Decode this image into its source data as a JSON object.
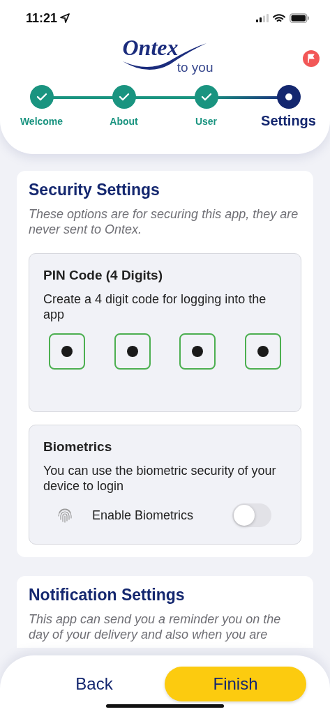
{
  "status_bar": {
    "time": "11:21"
  },
  "logo": {
    "brand": "Ontex",
    "tagline": "to you"
  },
  "steps": [
    {
      "label": "Welcome",
      "kind": "done"
    },
    {
      "label": "About",
      "kind": "done"
    },
    {
      "label": "User",
      "kind": "done"
    },
    {
      "label": "Settings",
      "kind": "current"
    }
  ],
  "security": {
    "title": "Security Settings",
    "description": "These options are for securing this app, they are never sent to Ontex.",
    "pin": {
      "title": "PIN Code (4 Digits)",
      "description": "Create a 4 digit code for logging into the app",
      "digits": [
        {
          "filled": true
        },
        {
          "filled": true
        },
        {
          "filled": true
        },
        {
          "filled": true
        }
      ]
    },
    "biometrics": {
      "title": "Biometrics",
      "description": "You can use the biometric security of your device to login",
      "toggle_label": "Enable Biometrics",
      "on": false
    }
  },
  "notifications": {
    "title": "Notification Settings",
    "description": "This app can send you a reminder you on the day of your delivery and also when you are"
  },
  "buttons": {
    "back": "Back",
    "finish": "Finish"
  }
}
